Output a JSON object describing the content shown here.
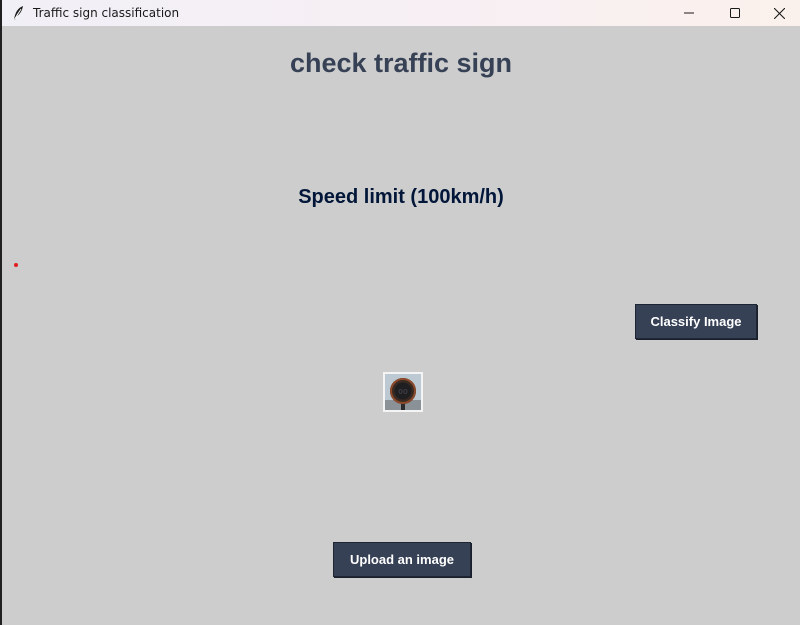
{
  "window": {
    "title": "Traffic sign classification",
    "icons": {
      "app": "feather-icon",
      "minimize": "minimize-icon",
      "maximize": "maximize-icon",
      "close": "close-icon"
    }
  },
  "main": {
    "heading": "check traffic sign",
    "result": "Speed limit (100km/h)",
    "classify_label": "Classify Image",
    "upload_label": "Upload an image"
  },
  "colors": {
    "background": "#cdcdcd",
    "heading": "#364156",
    "result": "#011638",
    "button": "#364156",
    "button_text": "#ffffff",
    "marker": "#e02020"
  }
}
